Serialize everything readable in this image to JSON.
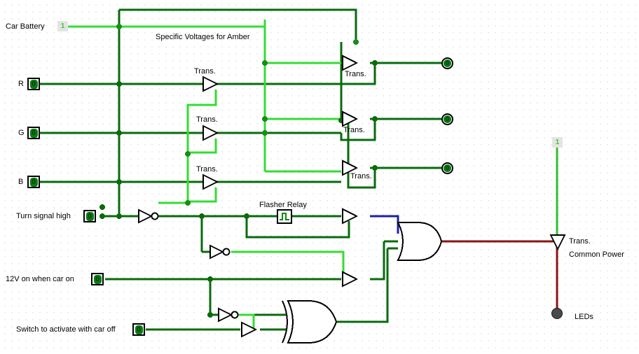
{
  "diagram": {
    "title": "Logic circuit schematic for RGB turn-signal / amber LED controller",
    "annotations": {
      "amber_note": "Specific Voltages for Amber",
      "flasher_relay": "Flasher Relay",
      "common_power": "Common Power",
      "leds": "LEDs"
    },
    "colors": {
      "wire_low": "#076b0c",
      "wire_high": "#33dd33",
      "wire_blue": "#2020a8",
      "wire_red": "#8b1416",
      "gate_outline": "#000000",
      "grid_dot": "#b9b9b9",
      "background": "#ffffff",
      "pin_green": "#0a7a12"
    },
    "inputs": [
      {
        "id": "car-battery",
        "label": "Car Battery",
        "type": "constant",
        "value": "1"
      },
      {
        "id": "r",
        "label": "R",
        "type": "toggle",
        "value": "0"
      },
      {
        "id": "g",
        "label": "G",
        "type": "toggle",
        "value": "0"
      },
      {
        "id": "b",
        "label": "B",
        "type": "toggle",
        "value": "0"
      },
      {
        "id": "turn-signal-high",
        "label": "Turn signal high",
        "type": "toggle",
        "value": "0"
      },
      {
        "id": "12v-car-on",
        "label": "12V on when car on",
        "type": "toggle",
        "value": "0"
      },
      {
        "id": "switch-car-off",
        "label": "Switch to activate with car off",
        "type": "toggle",
        "value": "0"
      },
      {
        "id": "common-power-source",
        "label": "",
        "type": "constant",
        "value": "1"
      }
    ],
    "outputs": [
      {
        "id": "out-r",
        "label": "",
        "value": "0"
      },
      {
        "id": "out-g",
        "label": "",
        "value": "0"
      },
      {
        "id": "out-b",
        "label": "",
        "value": "0"
      }
    ],
    "transistor_label": "Trans.",
    "transistors": [
      {
        "id": "trans-r-left",
        "label": "Trans."
      },
      {
        "id": "trans-g-left",
        "label": "Trans."
      },
      {
        "id": "trans-b-left",
        "label": "Trans."
      },
      {
        "id": "trans-r-right",
        "label": "Trans."
      },
      {
        "id": "trans-g-right",
        "label": "Trans."
      },
      {
        "id": "trans-b-right",
        "label": "Trans."
      },
      {
        "id": "trans-common-power",
        "label": "Trans."
      }
    ],
    "gates": [
      {
        "id": "not-turn-signal",
        "type": "NOT"
      },
      {
        "id": "not-mid",
        "type": "NOT"
      },
      {
        "id": "not-car-on",
        "type": "NOT"
      },
      {
        "id": "buf-flasher-out",
        "type": "BUFFER"
      },
      {
        "id": "buf-mid",
        "type": "BUFFER"
      },
      {
        "id": "buf-car-off",
        "type": "BUFFER"
      },
      {
        "id": "xor-bottom",
        "type": "XOR"
      },
      {
        "id": "or-main",
        "type": "OR"
      }
    ]
  }
}
